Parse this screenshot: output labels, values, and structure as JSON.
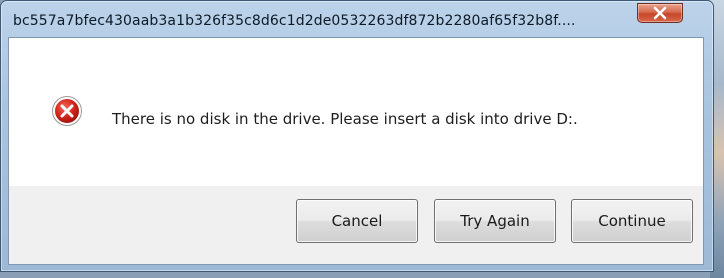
{
  "window": {
    "title": "bc557a7bfec430aab3a1b326f35c8d6c1d2de0532263df872b2280af65f32b8f...."
  },
  "icons": {
    "close": "close-icon",
    "status": "error-icon"
  },
  "dialog": {
    "message": "There is no disk in the drive. Please insert a disk into drive D:."
  },
  "buttons": {
    "cancel": "Cancel",
    "try_again": "Try Again",
    "continue": "Continue"
  },
  "colors": {
    "close_button": "#c7462a",
    "error_icon": "#c8231b",
    "titlebar": "#a9c4df"
  }
}
